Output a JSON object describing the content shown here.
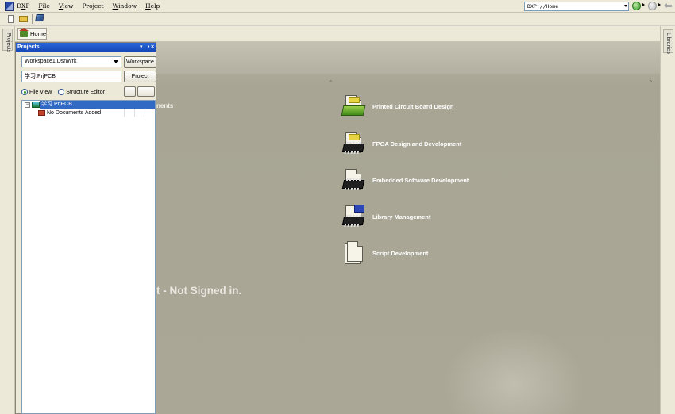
{
  "menubar": {
    "items": [
      {
        "label": "DXP",
        "key": "X"
      },
      {
        "label": "File",
        "key": "F"
      },
      {
        "label": "View",
        "key": "V"
      },
      {
        "label": "Project",
        "key": "C"
      },
      {
        "label": "Window",
        "key": "W"
      },
      {
        "label": "Help",
        "key": "H"
      }
    ],
    "address": "DXP://Home"
  },
  "side": {
    "left_tab": "Projects",
    "right_tab": "Libraries"
  },
  "home_tab": {
    "label": "Home"
  },
  "panel": {
    "title": "Projects",
    "workspace_value": "Workspace1.DsnWrk",
    "workspace_button": "Workspace",
    "project_value": "学习.PrjPCB",
    "project_button": "Project",
    "view_options": [
      "File View",
      "Structure Editor"
    ],
    "selected_view": "File View",
    "tree": {
      "root": "学习.PrjPCB",
      "child": "No Documents Added"
    }
  },
  "content": {
    "heading_partial": "nents",
    "signin_partial": "t - Not Signed in.",
    "tasks": [
      {
        "label": "Printed Circuit Board Design",
        "icon": "pcb-icon"
      },
      {
        "label": "FPGA Design and Development",
        "icon": "fpga-chip-icon"
      },
      {
        "label": "Embedded Software Development",
        "icon": "asm-chip-icon"
      },
      {
        "label": "Library Management",
        "icon": "library-chip-icon"
      },
      {
        "label": "Script Development",
        "icon": "script-doc-icon"
      }
    ]
  },
  "colors": {
    "title_bar": "#1548b8",
    "selection": "#316ac5",
    "content_bg": "#aaa797",
    "task_label": "#ffffff"
  }
}
